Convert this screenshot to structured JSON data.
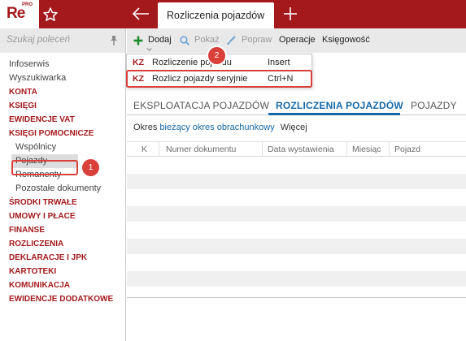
{
  "app": {
    "logo_text": "Re",
    "logo_sup": "PRO",
    "active_tab": "Rozliczenia pojazdów"
  },
  "sidebar": {
    "search_placeholder": "Szukaj poleceń",
    "items": [
      {
        "label": "Infoserwis",
        "kind": "plain"
      },
      {
        "label": "Wyszukiwarka",
        "kind": "plain"
      },
      {
        "label": "KONTA",
        "kind": "cat"
      },
      {
        "label": "KSIĘGI",
        "kind": "cat"
      },
      {
        "label": "EWIDENCJE VAT",
        "kind": "cat"
      },
      {
        "label": "KSIĘGI POMOCNICZE",
        "kind": "cat"
      },
      {
        "label": "Wspólnicy",
        "kind": "sub"
      },
      {
        "label": "Pojazdy",
        "kind": "sel"
      },
      {
        "label": "Remanenty",
        "kind": "sub"
      },
      {
        "label": "Pozostałe dokumenty",
        "kind": "sub"
      },
      {
        "label": "ŚRODKI TRWAŁE",
        "kind": "cat"
      },
      {
        "label": "UMOWY I PŁACE",
        "kind": "cat"
      },
      {
        "label": "FINANSE",
        "kind": "cat"
      },
      {
        "label": "ROZLICZENIA",
        "kind": "cat"
      },
      {
        "label": "DEKLARACJE I JPK",
        "kind": "cat"
      },
      {
        "label": "KARTOTEKI",
        "kind": "cat"
      },
      {
        "label": "KOMUNIKACJA",
        "kind": "cat"
      },
      {
        "label": "EWIDENCJE DODATKOWE",
        "kind": "cat"
      }
    ]
  },
  "toolbar": {
    "add": "Dodaj",
    "show": "Pokaż",
    "fix": "Popraw",
    "operations": "Operacje",
    "accounting": "Księgowość"
  },
  "dropdown": {
    "items": [
      {
        "code": "KZ",
        "label": "Rozliczenie pojazdu",
        "shortcut": "Insert"
      },
      {
        "code": "KZ",
        "label": "Rozlicz pojazdy seryjnie",
        "shortcut": "Ctrl+N"
      }
    ]
  },
  "main": {
    "tabs": [
      "EKSPLOATACJA POJAZDÓW",
      "ROZLICZENIA POJAZDÓW",
      "POJAZDY"
    ],
    "filter": {
      "prefix": "Okres",
      "period": "bieżący okres obrachunkowy",
      "more": "Więcej"
    },
    "columns": [
      "K",
      "Numer dokumentu",
      "Data wystawienia",
      "Miesiąc",
      "Pojazd"
    ]
  },
  "callouts": [
    "1",
    "2"
  ],
  "colors": {
    "brand": "#a3191c",
    "accent": "#1668a8",
    "callout": "#d9403a",
    "add_icon": "#1e8a2e"
  }
}
